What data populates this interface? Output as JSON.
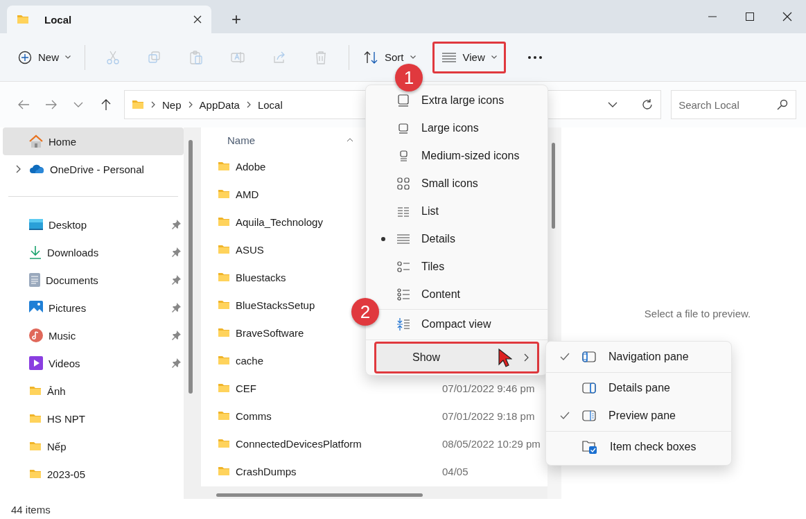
{
  "window": {
    "tab_title": "Local",
    "new_tab": "+"
  },
  "toolbar": [
    {
      "kind": "new",
      "label": "New",
      "disabled": false,
      "annotated": false
    },
    {
      "kind": "cut",
      "disabled": true,
      "annotated": false
    },
    {
      "kind": "copy",
      "disabled": true,
      "annotated": false
    },
    {
      "kind": "paste",
      "disabled": true,
      "annotated": false
    },
    {
      "kind": "rename",
      "disabled": true,
      "annotated": false
    },
    {
      "kind": "share",
      "disabled": true,
      "annotated": false
    },
    {
      "kind": "delete",
      "disabled": true,
      "annotated": false
    },
    {
      "kind": "sort",
      "label": "Sort",
      "disabled": false,
      "annotated": false
    },
    {
      "kind": "view",
      "label": "View",
      "disabled": false,
      "annotated": true
    },
    {
      "kind": "more",
      "disabled": false,
      "annotated": false
    }
  ],
  "address": {
    "path": [
      "Nep",
      "AppData",
      "Local"
    ],
    "search_placeholder": "Search Local"
  },
  "sidebar": {
    "items": [
      {
        "kind": "home",
        "label": "Home",
        "selected": true,
        "expandable": false
      },
      {
        "kind": "cloud",
        "label": "OneDrive - Personal",
        "selected": false,
        "expandable": true
      }
    ],
    "quick_access": [
      {
        "kind": "desktop",
        "label": "Desktop",
        "pinned": true,
        "selected": false
      },
      {
        "kind": "downloads",
        "label": "Downloads",
        "pinned": true,
        "selected": false
      },
      {
        "kind": "documents",
        "label": "Documents",
        "pinned": true,
        "selected": false
      },
      {
        "kind": "pictures",
        "label": "Pictures",
        "pinned": true,
        "selected": false
      },
      {
        "kind": "music",
        "label": "Music",
        "pinned": true,
        "selected": false
      },
      {
        "kind": "videos",
        "label": "Videos",
        "pinned": true,
        "selected": false
      },
      {
        "kind": "folder",
        "label": "Ảnh",
        "pinned": false,
        "selected": false
      },
      {
        "kind": "folder",
        "label": "HS NPT",
        "pinned": false,
        "selected": false
      },
      {
        "kind": "folder",
        "label": "Nếp",
        "pinned": false,
        "selected": false
      },
      {
        "kind": "folder",
        "label": "2023-05",
        "pinned": false,
        "selected": false
      }
    ]
  },
  "files": {
    "name_header": "Name",
    "rows": [
      {
        "name": "Adobe"
      },
      {
        "name": "AMD"
      },
      {
        "name": "Aquila_Technology"
      },
      {
        "name": "ASUS"
      },
      {
        "name": "Bluestacks"
      },
      {
        "name": "BlueStacksSetup"
      },
      {
        "name": "BraveSoftware"
      },
      {
        "name": "cache"
      },
      {
        "name": "CEF",
        "date": "07/01/2022 9:46 pm"
      },
      {
        "name": "Comms",
        "date": "07/01/2022 9:18 pm"
      },
      {
        "name": "ConnectedDevicesPlatform",
        "date": "08/05/2022 10:29 pm"
      },
      {
        "name": "CrashDumps",
        "date": "04/05"
      }
    ]
  },
  "preview": {
    "message": "Select a file to preview."
  },
  "status_bar": {
    "count": "44 items"
  },
  "view_menu": {
    "items": [
      {
        "kind": "extra-large",
        "label": "Extra large icons",
        "selected": false
      },
      {
        "kind": "large",
        "label": "Large icons",
        "selected": false
      },
      {
        "kind": "medium",
        "label": "Medium-sized icons",
        "selected": false
      },
      {
        "kind": "small",
        "label": "Small icons",
        "selected": false
      },
      {
        "kind": "list",
        "label": "List",
        "selected": false
      },
      {
        "kind": "details",
        "label": "Details",
        "selected": true
      },
      {
        "kind": "tiles",
        "label": "Tiles",
        "selected": false
      },
      {
        "kind": "content",
        "label": "Content",
        "selected": false
      },
      {
        "kind": "compact",
        "label": "Compact view",
        "selected": false
      },
      {
        "kind": "show",
        "label": "Show",
        "highlighted": true,
        "annotated": true
      }
    ]
  },
  "show_submenu": {
    "items": [
      {
        "kind": "navigation",
        "label": "Navigation pane",
        "checked": true
      },
      {
        "kind": "details-pane",
        "label": "Details pane",
        "checked": false
      },
      {
        "kind": "preview-pane",
        "label": "Preview pane",
        "checked": true
      },
      {
        "kind": "checkboxes",
        "label": "Item check boxes",
        "checked": false
      }
    ]
  },
  "annotations": [
    {
      "number": "1"
    },
    {
      "number": "2"
    }
  ]
}
